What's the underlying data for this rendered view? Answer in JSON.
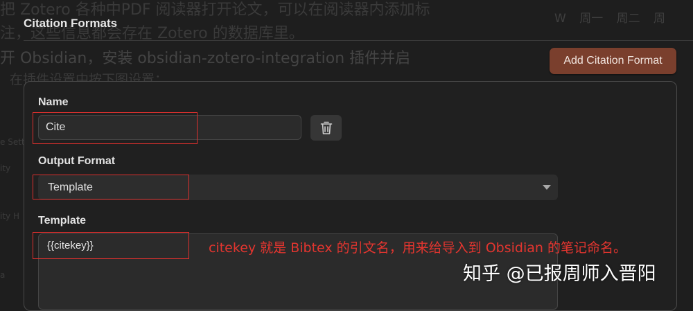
{
  "background_text": {
    "line1": "把 Zotero 各种中PDF 阅读器打开论文，可以在阅读器内添加标",
    "line2": "注，这些信息都会存在 Zotero 的数据库里。",
    "line3": "开 Obsidian，安装 obsidian-zotero-integration 插件并启",
    "line4": "在插件设置中按下图设置：",
    "weekdays": "W 周一 周二 周",
    "side_items": [
      "e Setti",
      "ity",
      "ity H",
      "a"
    ]
  },
  "section": {
    "title": "Citation Formats",
    "add_button_label": "Add Citation Format"
  },
  "form": {
    "name_label": "Name",
    "name_value": "Cite",
    "output_format_label": "Output Format",
    "output_format_value": "Template",
    "template_label": "Template",
    "template_value": "{{citekey}}"
  },
  "annotation": {
    "text": "citekey 就是 Bibtex 的引文名，用来给导入到 Obsidian 的笔记命名。",
    "color": "#e3352f"
  },
  "watermark": "知乎 @已报周师入晋阳",
  "colors": {
    "accent_button": "#7a3f2d",
    "highlight_box": "#e0302e",
    "background": "#1e1e1e"
  }
}
